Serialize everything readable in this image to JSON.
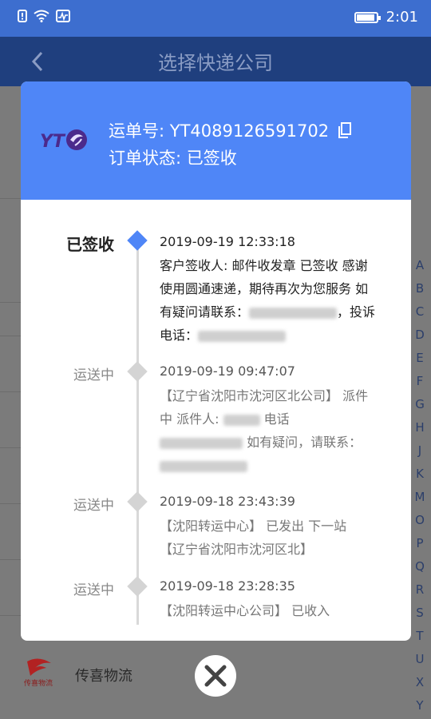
{
  "status_bar": {
    "time": "2:01"
  },
  "app_bar": {
    "title": "选择快递公司"
  },
  "index_letters": [
    "A",
    "B",
    "C",
    "D",
    "E",
    "F",
    "G",
    "H",
    "J",
    "K",
    "M",
    "O",
    "P",
    "Q",
    "R",
    "S",
    "T",
    "U",
    "X",
    "Y"
  ],
  "courier_list": [
    {
      "name": "传喜物流",
      "logo_text": "传喜物流"
    }
  ],
  "modal": {
    "tracking_label": "运单号: YT4089126591702",
    "status_label": "订单状态: 已签收",
    "logo_text": "YTO",
    "events": [
      {
        "label": "已签收",
        "time": "2019-09-19 12:33:18",
        "lines": [
          "客户签收人: 邮件收发章 已签收  感谢",
          "使用圆通速递，期待再次为您服务 如",
          "有疑问请联系：",
          "电话："
        ],
        "line_suffix": "，投诉",
        "current": true
      },
      {
        "label": "运送中",
        "time": "2019-09-19 09:47:07",
        "lines": [
          "【辽宁省沈阳市沈河区北公司】 派件",
          "中  派件人:",
          "如有疑问，请联系：",
          ""
        ],
        "line_suffix": "电话",
        "current": false
      },
      {
        "label": "运送中",
        "time": "2019-09-18 23:43:39",
        "lines": [
          "【沈阳转运中心】 已发出 下一站",
          "【辽宁省沈阳市沈河区北】"
        ],
        "current": false
      },
      {
        "label": "运送中",
        "time": "2019-09-18 23:28:35",
        "lines": [
          "【沈阳转运中心公司】 已收入"
        ],
        "current": false
      }
    ]
  },
  "colors": {
    "status_bar": "#3d6ecf",
    "modal_header": "#4f86f7",
    "current_node": "#4f86f7"
  }
}
